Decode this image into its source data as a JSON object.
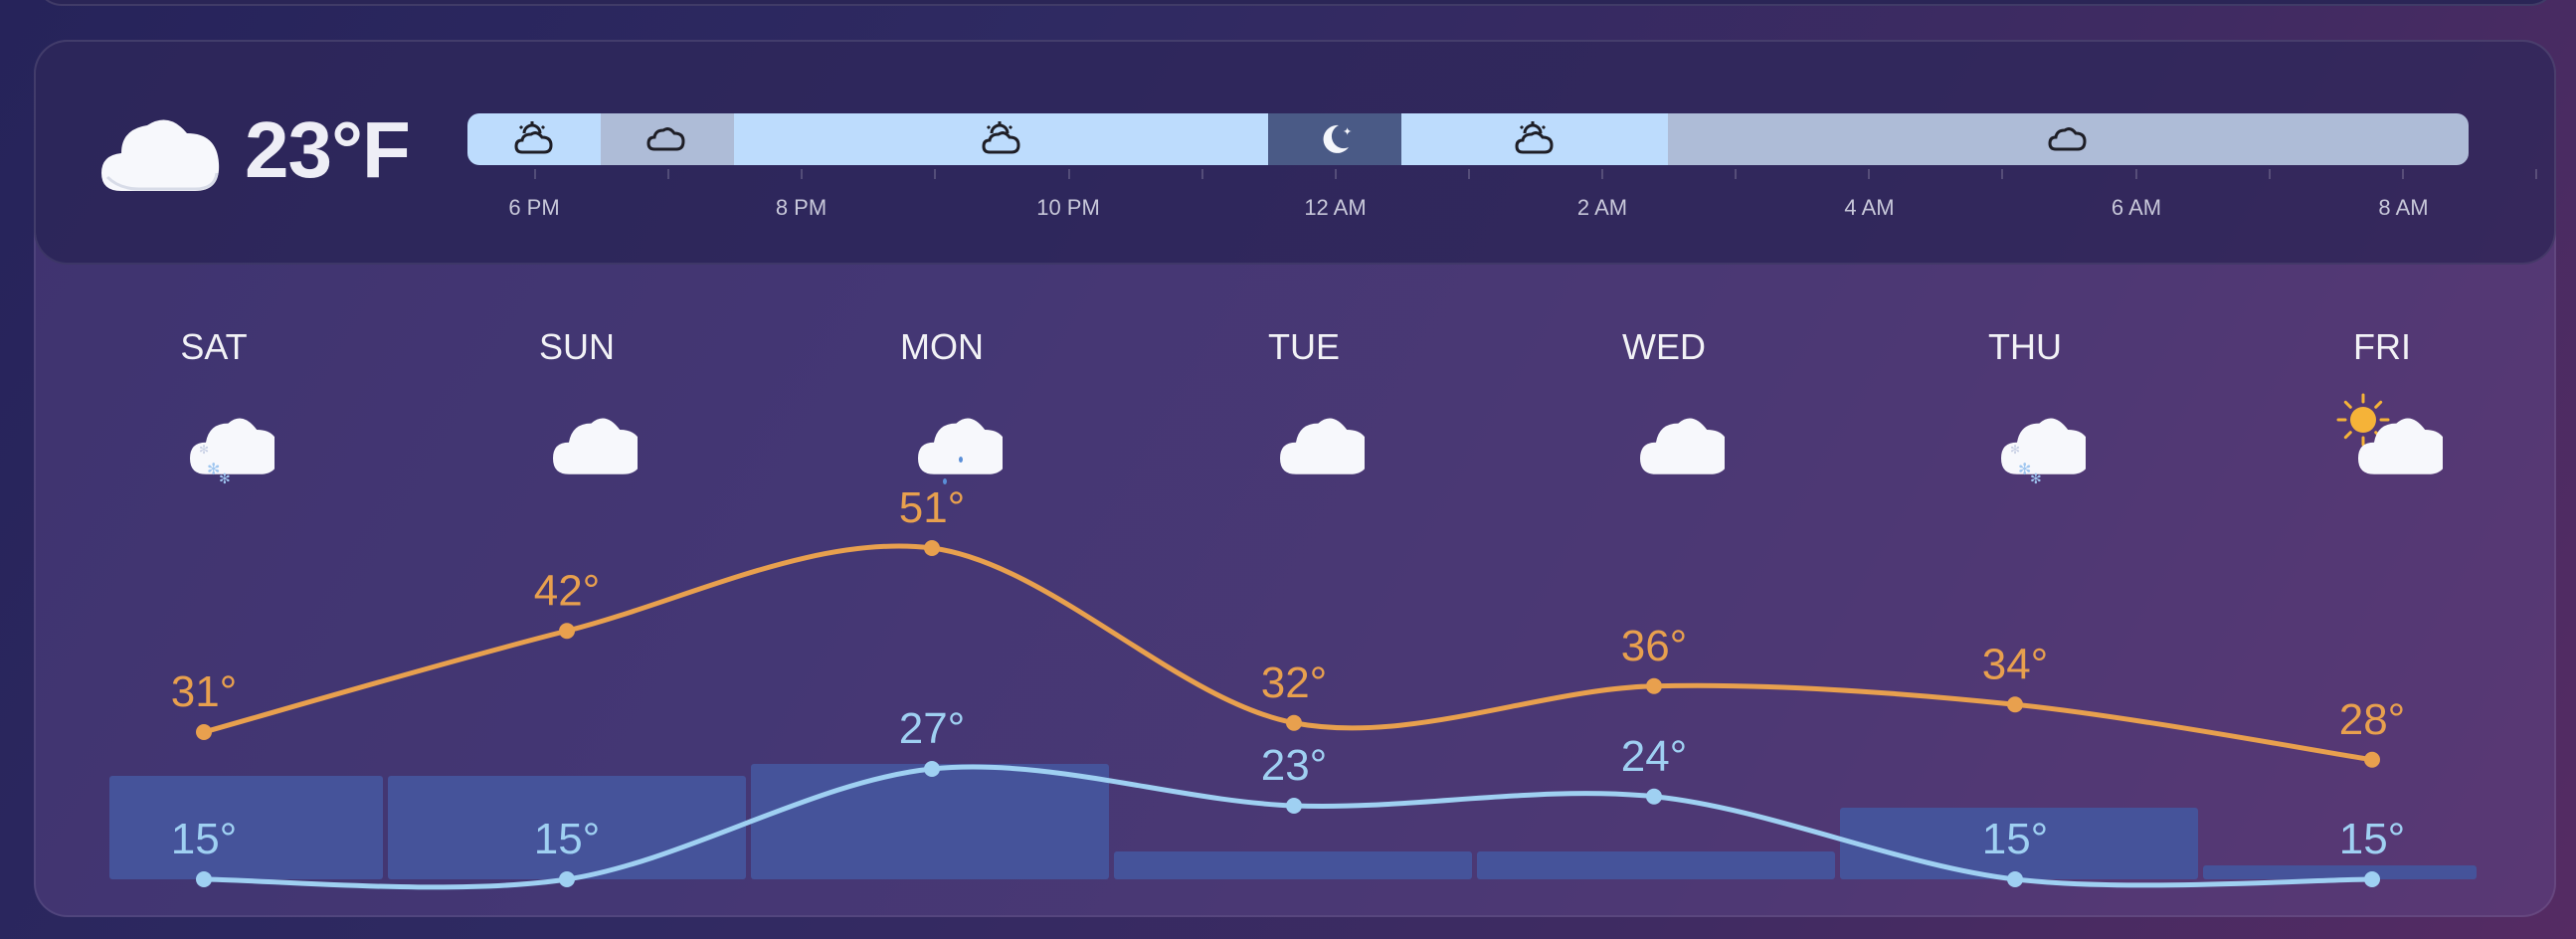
{
  "current": {
    "temperature": "23°F",
    "icon": "cloud-icon"
  },
  "timeline": {
    "segments": [
      {
        "icon": "partly-cloudy-night-icon",
        "color": "#bddcfd",
        "start": 0,
        "end": 1
      },
      {
        "icon": "cloud-icon",
        "color": "#aebcd7",
        "start": 1,
        "end": 2
      },
      {
        "icon": "partly-cloudy-night-icon",
        "color": "#bddcfd",
        "start": 2,
        "end": 6
      },
      {
        "icon": "moon-icon",
        "color": "#4a5a86",
        "start": 6,
        "end": 7
      },
      {
        "icon": "partly-cloudy-night-icon",
        "color": "#bddcfd",
        "start": 7,
        "end": 9
      },
      {
        "icon": "cloud-icon",
        "color": "#aebcd7",
        "start": 9,
        "end": 15
      }
    ],
    "labels": [
      "6 PM",
      "8 PM",
      "10 PM",
      "12 AM",
      "2 AM",
      "4 AM",
      "6 AM",
      "8 AM"
    ]
  },
  "forecast": {
    "days": [
      {
        "name": "SAT",
        "icon": "snow-cloud-icon"
      },
      {
        "name": "SUN",
        "icon": "cloud-icon"
      },
      {
        "name": "MON",
        "icon": "rain-cloud-icon"
      },
      {
        "name": "TUE",
        "icon": "cloud-icon"
      },
      {
        "name": "WED",
        "icon": "cloud-icon"
      },
      {
        "name": "THU",
        "icon": "snow-cloud-icon"
      },
      {
        "name": "FRI",
        "icon": "partly-sunny-icon"
      }
    ]
  },
  "chart_data": {
    "type": "line",
    "categories": [
      "SAT",
      "SUN",
      "MON",
      "TUE",
      "WED",
      "THU",
      "FRI"
    ],
    "series": [
      {
        "values": [
          31,
          42,
          51,
          32,
          36,
          34,
          28
        ],
        "labels": [
          "31°",
          "42°",
          "51°",
          "32°",
          "36°",
          "34°",
          "28°"
        ],
        "color": "#e8a04e"
      },
      {
        "values": [
          15,
          15,
          27,
          23,
          24,
          15,
          15
        ],
        "labels": [
          "15°",
          "15°",
          "27°",
          "23°",
          "24°",
          "15°",
          "15°"
        ],
        "color": "#9fd0f2"
      }
    ],
    "precipitation_bars": [
      0.52,
      0.52,
      0.58,
      0.14,
      0.14,
      0.36,
      0.07
    ],
    "bar_color": "#45539a"
  }
}
